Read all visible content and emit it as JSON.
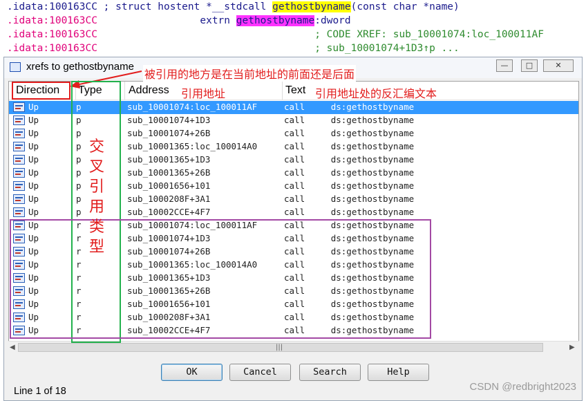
{
  "code": {
    "line1": {
      "addr": ".idata:100163CC",
      "pre": " ; struct hostent *__stdcall ",
      "hl": "gethostbyname",
      "post": "(const char *name)"
    },
    "line2": {
      "addr": ".idata:100163CC",
      "pre": "                 extrn ",
      "hl": "gethostbyname",
      "post": ":dword"
    },
    "line3": {
      "addr": ".idata:100163CC",
      "cmt": "                                    ; CODE XREF: sub_10001074:loc_100011AF"
    },
    "line4": {
      "addr": ".idata:100163CC",
      "cmt": "                                    ; sub_10001074+1D3↑p ..."
    }
  },
  "window": {
    "title": "xrefs to gethostbyname",
    "minimize": "—",
    "maximize": "□",
    "close": "✕"
  },
  "columns": {
    "direction": "Direction",
    "type": "Type",
    "address": "Address",
    "text": "Text"
  },
  "rows": [
    {
      "dir": "Up",
      "type": "p",
      "addr": "sub_10001074:loc_100011AF",
      "text": "call     ds:gethostbyname"
    },
    {
      "dir": "Up",
      "type": "p",
      "addr": "sub_10001074+1D3",
      "text": "call     ds:gethostbyname"
    },
    {
      "dir": "Up",
      "type": "p",
      "addr": "sub_10001074+26B",
      "text": "call     ds:gethostbyname"
    },
    {
      "dir": "Up",
      "type": "p",
      "addr": "sub_10001365:loc_100014A0",
      "text": "call     ds:gethostbyname"
    },
    {
      "dir": "Up",
      "type": "p",
      "addr": "sub_10001365+1D3",
      "text": "call     ds:gethostbyname"
    },
    {
      "dir": "Up",
      "type": "p",
      "addr": "sub_10001365+26B",
      "text": "call     ds:gethostbyname"
    },
    {
      "dir": "Up",
      "type": "p",
      "addr": "sub_10001656+101",
      "text": "call     ds:gethostbyname"
    },
    {
      "dir": "Up",
      "type": "p",
      "addr": "sub_1000208F+3A1",
      "text": "call     ds:gethostbyname"
    },
    {
      "dir": "Up",
      "type": "p",
      "addr": "sub_10002CCE+4F7",
      "text": "call     ds:gethostbyname"
    },
    {
      "dir": "Up",
      "type": "r",
      "addr": "sub_10001074:loc_100011AF",
      "text": "call     ds:gethostbyname"
    },
    {
      "dir": "Up",
      "type": "r",
      "addr": "sub_10001074+1D3",
      "text": "call     ds:gethostbyname"
    },
    {
      "dir": "Up",
      "type": "r",
      "addr": "sub_10001074+26B",
      "text": "call     ds:gethostbyname"
    },
    {
      "dir": "Up",
      "type": "r",
      "addr": "sub_10001365:loc_100014A0",
      "text": "call     ds:gethostbyname"
    },
    {
      "dir": "Up",
      "type": "r",
      "addr": "sub_10001365+1D3",
      "text": "call     ds:gethostbyname"
    },
    {
      "dir": "Up",
      "type": "r",
      "addr": "sub_10001365+26B",
      "text": "call     ds:gethostbyname"
    },
    {
      "dir": "Up",
      "type": "r",
      "addr": "sub_10001656+101",
      "text": "call     ds:gethostbyname"
    },
    {
      "dir": "Up",
      "type": "r",
      "addr": "sub_1000208F+3A1",
      "text": "call     ds:gethostbyname"
    },
    {
      "dir": "Up",
      "type": "r",
      "addr": "sub_10002CCE+4F7",
      "text": "call     ds:gethostbyname"
    }
  ],
  "selected_row": 0,
  "scroll": {
    "left": "◀",
    "right": "▶",
    "grip": "|||"
  },
  "buttons": {
    "ok": "OK",
    "cancel": "Cancel",
    "search": "Search",
    "help": "Help"
  },
  "status": "Line 1 of 18",
  "annotations": {
    "direction_note": "被引用的地方是在当前地址的前面还是后面",
    "address_note": "引用地址",
    "text_note": "引用地址处的反汇编文本",
    "type_note": [
      "交",
      "叉",
      "引",
      "用",
      "类",
      "型"
    ]
  },
  "watermark": "CSDN @redbright2023",
  "colors": {
    "annotation": "#e21d1d",
    "type_box": "#22b14c",
    "r_group_box": "#a349a4",
    "selection": "#3399ff"
  }
}
